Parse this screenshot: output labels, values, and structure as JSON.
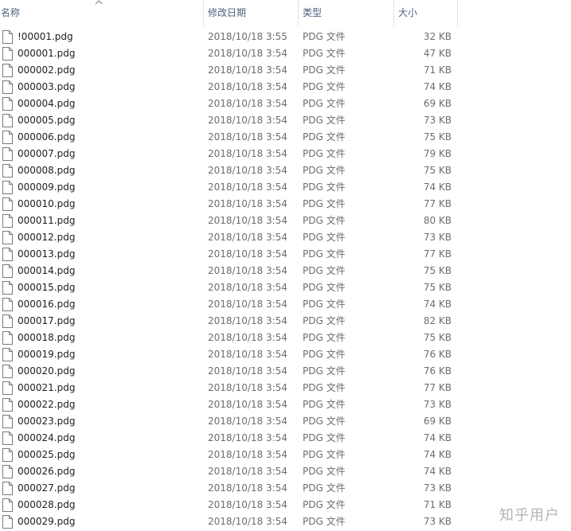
{
  "header": {
    "name_label": "名称",
    "date_label": "修改日期",
    "type_label": "类型",
    "size_label": "大小",
    "sort_icon": "chevron-up-icon"
  },
  "file_icon": "file-icon",
  "files": [
    {
      "name": "!00001.pdg",
      "date": "2018/10/18 3:55",
      "type": "PDG 文件",
      "size": "32 KB"
    },
    {
      "name": "000001.pdg",
      "date": "2018/10/18 3:54",
      "type": "PDG 文件",
      "size": "47 KB"
    },
    {
      "name": "000002.pdg",
      "date": "2018/10/18 3:54",
      "type": "PDG 文件",
      "size": "71 KB"
    },
    {
      "name": "000003.pdg",
      "date": "2018/10/18 3:54",
      "type": "PDG 文件",
      "size": "74 KB"
    },
    {
      "name": "000004.pdg",
      "date": "2018/10/18 3:54",
      "type": "PDG 文件",
      "size": "69 KB"
    },
    {
      "name": "000005.pdg",
      "date": "2018/10/18 3:54",
      "type": "PDG 文件",
      "size": "73 KB"
    },
    {
      "name": "000006.pdg",
      "date": "2018/10/18 3:54",
      "type": "PDG 文件",
      "size": "75 KB"
    },
    {
      "name": "000007.pdg",
      "date": "2018/10/18 3:54",
      "type": "PDG 文件",
      "size": "79 KB"
    },
    {
      "name": "000008.pdg",
      "date": "2018/10/18 3:54",
      "type": "PDG 文件",
      "size": "75 KB"
    },
    {
      "name": "000009.pdg",
      "date": "2018/10/18 3:54",
      "type": "PDG 文件",
      "size": "74 KB"
    },
    {
      "name": "000010.pdg",
      "date": "2018/10/18 3:54",
      "type": "PDG 文件",
      "size": "77 KB"
    },
    {
      "name": "000011.pdg",
      "date": "2018/10/18 3:54",
      "type": "PDG 文件",
      "size": "80 KB"
    },
    {
      "name": "000012.pdg",
      "date": "2018/10/18 3:54",
      "type": "PDG 文件",
      "size": "73 KB"
    },
    {
      "name": "000013.pdg",
      "date": "2018/10/18 3:54",
      "type": "PDG 文件",
      "size": "77 KB"
    },
    {
      "name": "000014.pdg",
      "date": "2018/10/18 3:54",
      "type": "PDG 文件",
      "size": "75 KB"
    },
    {
      "name": "000015.pdg",
      "date": "2018/10/18 3:54",
      "type": "PDG 文件",
      "size": "75 KB"
    },
    {
      "name": "000016.pdg",
      "date": "2018/10/18 3:54",
      "type": "PDG 文件",
      "size": "74 KB"
    },
    {
      "name": "000017.pdg",
      "date": "2018/10/18 3:54",
      "type": "PDG 文件",
      "size": "82 KB"
    },
    {
      "name": "000018.pdg",
      "date": "2018/10/18 3:54",
      "type": "PDG 文件",
      "size": "75 KB"
    },
    {
      "name": "000019.pdg",
      "date": "2018/10/18 3:54",
      "type": "PDG 文件",
      "size": "76 KB"
    },
    {
      "name": "000020.pdg",
      "date": "2018/10/18 3:54",
      "type": "PDG 文件",
      "size": "76 KB"
    },
    {
      "name": "000021.pdg",
      "date": "2018/10/18 3:54",
      "type": "PDG 文件",
      "size": "77 KB"
    },
    {
      "name": "000022.pdg",
      "date": "2018/10/18 3:54",
      "type": "PDG 文件",
      "size": "73 KB"
    },
    {
      "name": "000023.pdg",
      "date": "2018/10/18 3:54",
      "type": "PDG 文件",
      "size": "69 KB"
    },
    {
      "name": "000024.pdg",
      "date": "2018/10/18 3:54",
      "type": "PDG 文件",
      "size": "74 KB"
    },
    {
      "name": "000025.pdg",
      "date": "2018/10/18 3:54",
      "type": "PDG 文件",
      "size": "74 KB"
    },
    {
      "name": "000026.pdg",
      "date": "2018/10/18 3:54",
      "type": "PDG 文件",
      "size": "74 KB"
    },
    {
      "name": "000027.pdg",
      "date": "2018/10/18 3:54",
      "type": "PDG 文件",
      "size": "73 KB"
    },
    {
      "name": "000028.pdg",
      "date": "2018/10/18 3:54",
      "type": "PDG 文件",
      "size": "71 KB"
    },
    {
      "name": "000029.pdg",
      "date": "2018/10/18 3:54",
      "type": "PDG 文件",
      "size": "73 KB"
    }
  ],
  "watermark": "知乎用户",
  "colors": {
    "header_text": "#4c607a",
    "name_text": "#1e1e1e",
    "detail_text": "#6d6d6d",
    "separator": "#e5e5e5"
  }
}
